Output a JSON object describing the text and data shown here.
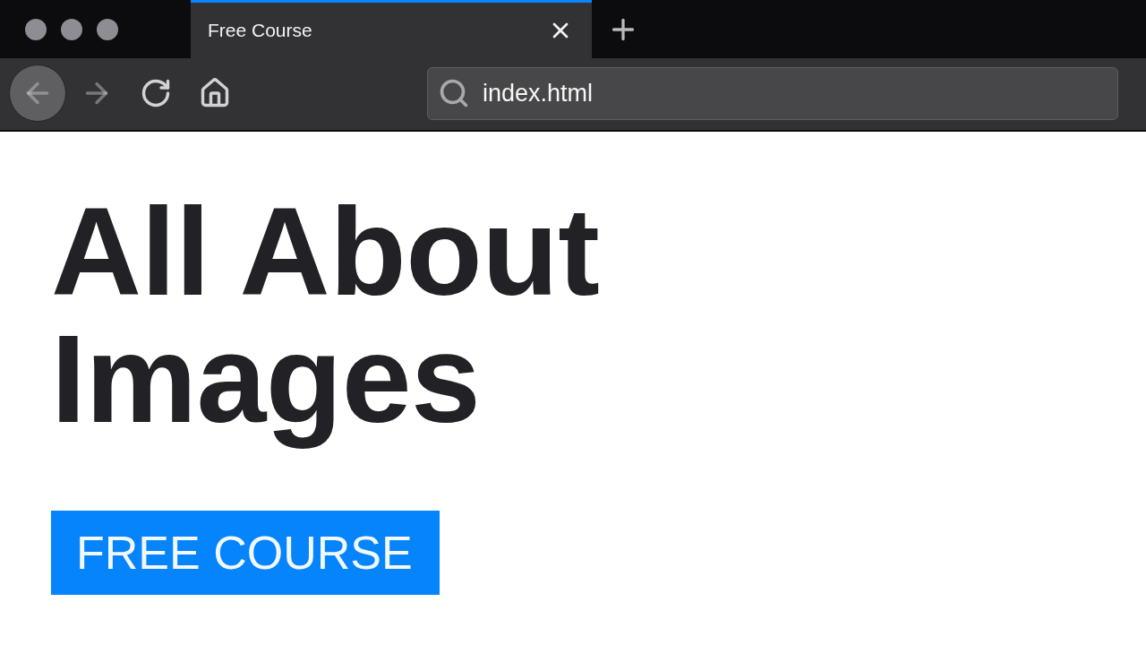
{
  "window": {
    "tabs": [
      {
        "label": "Free Course",
        "selected": true
      }
    ]
  },
  "toolbar": {
    "nav_buttons": [
      {
        "kind": "back",
        "disabled": true,
        "hovered": true
      },
      {
        "kind": "forward",
        "disabled": true,
        "hovered": false
      },
      {
        "kind": "reload",
        "disabled": false,
        "hovered": false
      },
      {
        "kind": "home",
        "disabled": false,
        "hovered": false
      }
    ],
    "address_bar": {
      "value": "index.html"
    }
  },
  "page": {
    "heading": "All About Images",
    "button": "FREE COURSE"
  }
}
